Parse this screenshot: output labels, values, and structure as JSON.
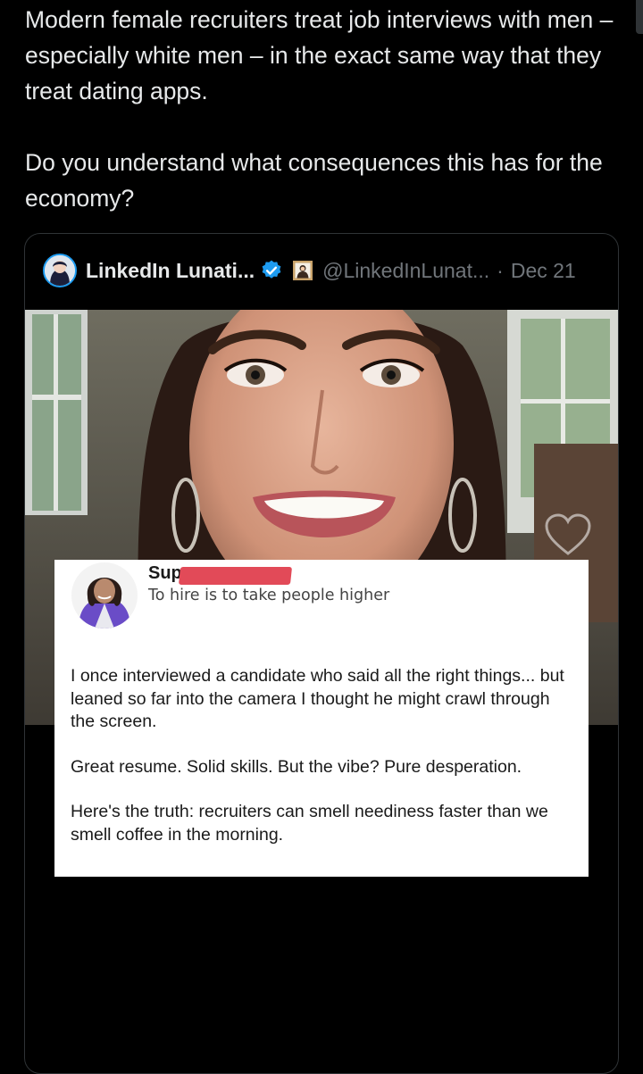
{
  "tweet": {
    "paragraphs": [
      "Modern female recruiters treat job interviews with men – especially white men – in the exact same way that they treat dating apps.",
      "Do you understand what consequences this has for the economy?"
    ]
  },
  "quote": {
    "display_name": "LinkedIn Lunati...",
    "handle": "@LinkedInLunat...",
    "separator": "·",
    "date": "Dec 21",
    "verified": true,
    "icons": {
      "avatar": "avatar",
      "verified": "verified-badge-icon",
      "emoji": "framed-picture-emoji-icon"
    },
    "colors": {
      "verified": "#1d9bf0",
      "muted_text": "#71767b"
    }
  },
  "post": {
    "author_name": "Sup",
    "tagline": "To hire is to take people higher",
    "paragraphs": [
      "I once interviewed a candidate who said all the right things... but leaned so far into the camera I thought he might crawl through the screen.",
      "Great resume. Solid skills. But the vibe? Pure desperation.",
      "Here's the truth: recruiters can smell neediness faster than we smell coffee in the morning."
    ],
    "colors": {
      "redaction": "#e24a58"
    }
  }
}
